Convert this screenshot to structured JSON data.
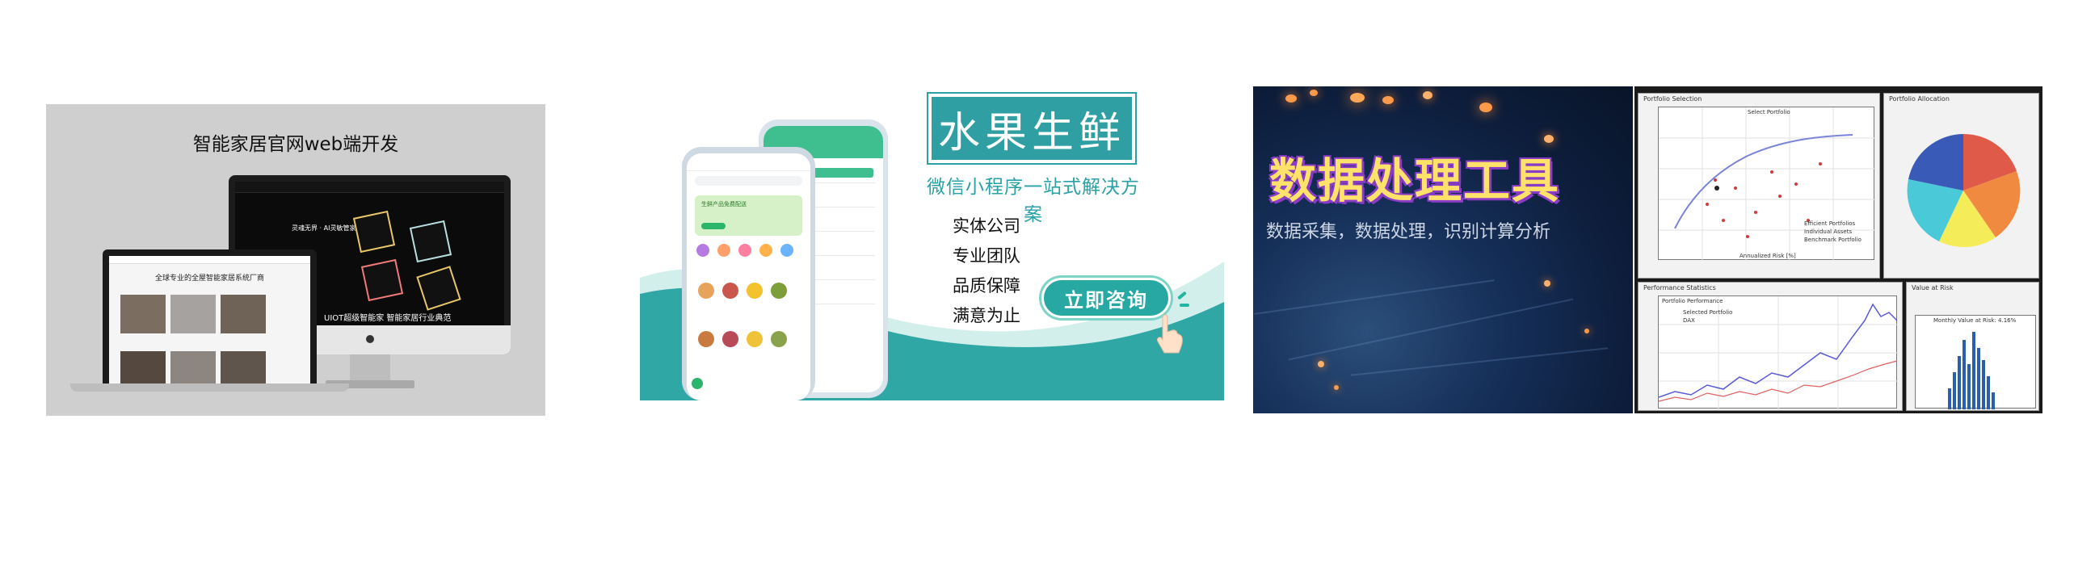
{
  "card1": {
    "title": "智能家居官网web端开发",
    "imac_caption": "UIOT超级智能家 智能家居行业典范",
    "imac_sub": "灵魂无界 · AI灵敏管家",
    "laptop_title": "全球专业的全屋智能家居系统厂商"
  },
  "card2": {
    "title": "水果生鲜",
    "subtitle": "微信小程序一站式解决方案",
    "features": [
      "实体公司",
      "专业团队",
      "品质保障",
      "满意为止"
    ],
    "consult_button": "立即咨询",
    "banner_text": "生鲜产品免费配送",
    "colors": {
      "teal": "#2f9fa3",
      "green": "#3fbf8f"
    }
  },
  "card3": {
    "title": "数据处理工具",
    "description": "数据采集，数据处理，识别计算分析"
  },
  "card4": {
    "panel_portfolio_selection": "Portfolio Selection",
    "panel_portfolio_allocation": "Portfolio Allocation",
    "panel_performance_statistics": "Performance Statistics",
    "panel_value_at_risk": "Value at Risk",
    "plot_select_portfolio": "Select Portfolio",
    "plot_portfolio_performance": "Portfolio Performance",
    "plot_monthly_var": "Monthly Value at Risk: 4.16%",
    "legend_efficient": "Efficient Portfolios",
    "legend_individual": "Individual Assets",
    "legend_benchmark": "Benchmark Portfolio",
    "legend_selected": "Selected Portfolio",
    "legend_dax": "DAX",
    "xlabel_risk": "Annualized Risk [%]"
  }
}
